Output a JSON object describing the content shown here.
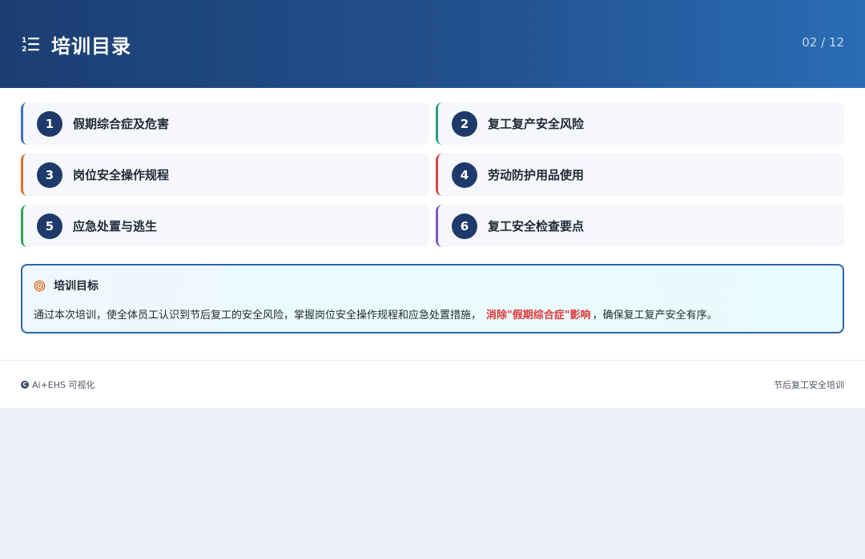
{
  "header": {
    "icon": "numbered-list-icon",
    "title": "培训目录",
    "page_indicator": "02 / 12"
  },
  "items": [
    {
      "number": "1",
      "label": "假期综合症及危害",
      "accent": "#3a6fbf"
    },
    {
      "number": "2",
      "label": "复工复产安全风险",
      "accent": "#2a9d84"
    },
    {
      "number": "3",
      "label": "岗位安全操作规程",
      "accent": "#e0712c"
    },
    {
      "number": "4",
      "label": "劳动防护用品使用",
      "accent": "#d64545"
    },
    {
      "number": "5",
      "label": "应急处置与逃生",
      "accent": "#34a058"
    },
    {
      "number": "6",
      "label": "复工安全检查要点",
      "accent": "#7c59c8"
    }
  ],
  "goal": {
    "icon": "target-icon",
    "title": "培训目标",
    "text_before": "通过本次培训，使全体员工认识到节后复工的安全风险，掌握岗位安全操作规程和应急处置措施，",
    "highlight": "消除\"假期综合症\"影响",
    "text_after": "，确保复工复产安全有序。",
    "highlight_color": "#dc3838",
    "border_color": "#2c63ae"
  },
  "footer": {
    "brand_icon": "copyright-icon",
    "brand": "Ai+EHS 可视化",
    "title": "节后复工安全培训"
  },
  "colors": {
    "header_start": "#1c3e72",
    "header_end": "#2a6db5",
    "number_badge": "#1e3a6a"
  }
}
